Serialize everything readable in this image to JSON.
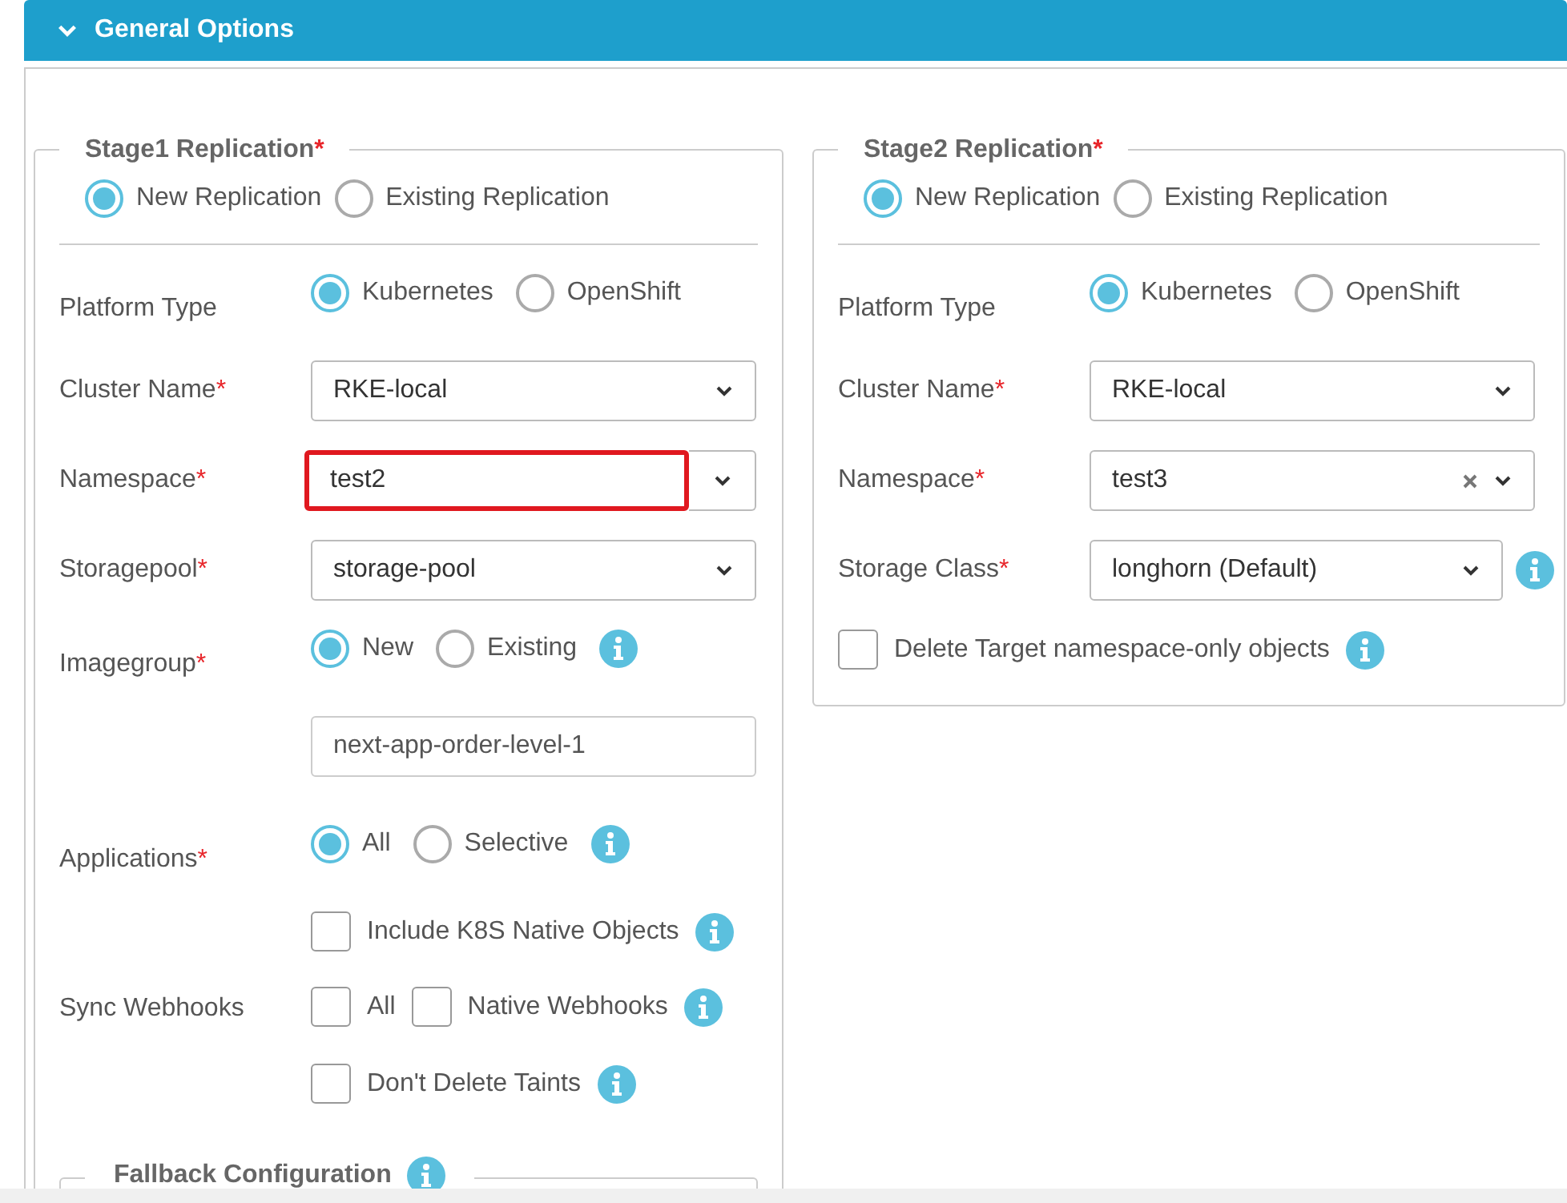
{
  "header": {
    "title": "General Options",
    "expanded": true
  },
  "stages": [
    {
      "title": "Stage1 Replication",
      "mark": "*",
      "modes": [
        {
          "label": "New Replication",
          "selected": true
        },
        {
          "label": "Existing Replication",
          "selected": false
        }
      ],
      "fields": [
        {
          "kind": "radio",
          "label": "Platform Type",
          "options": [
            {
              "label": "Kubernetes",
              "selected": true
            },
            {
              "label": "OpenShift",
              "selected": false
            }
          ]
        },
        {
          "kind": "select",
          "label": "Cluster Name",
          "mark": "*",
          "value": "RKE-local"
        },
        {
          "kind": "select",
          "label": "Namespace",
          "mark": "*",
          "value": "test2",
          "highlighted": true
        },
        {
          "kind": "select",
          "label": "Storagepool",
          "mark": "*",
          "value": "storage-pool"
        },
        {
          "kind": "radio",
          "label": "Imagegroup",
          "mark": "*",
          "info": true,
          "options": [
            {
              "label": "New",
              "selected": true
            },
            {
              "label": "Existing",
              "selected": false
            }
          ]
        },
        {
          "kind": "text",
          "value": "next-app-order-level-1"
        },
        {
          "kind": "radio",
          "label": "Applications",
          "mark": "*",
          "info": true,
          "options": [
            {
              "label": "All",
              "selected": true
            },
            {
              "label": "Selective",
              "selected": false
            }
          ]
        },
        {
          "kind": "checkbox",
          "info": true,
          "options": [
            {
              "label": "Include K8S Native Objects",
              "checked": false
            }
          ]
        },
        {
          "kind": "checkbox",
          "label": "Sync Webhooks",
          "info": true,
          "options": [
            {
              "label": "All",
              "checked": false
            },
            {
              "label": "Native Webhooks",
              "checked": false
            }
          ]
        },
        {
          "kind": "checkbox",
          "info": true,
          "options": [
            {
              "label": "Don't Delete Taints",
              "checked": false
            }
          ]
        }
      ],
      "subsection": {
        "title": "Fallback Configuration",
        "info": true
      }
    },
    {
      "title": "Stage2 Replication",
      "mark": "*",
      "modes": [
        {
          "label": "New Replication",
          "selected": true
        },
        {
          "label": "Existing Replication",
          "selected": false
        }
      ],
      "fields": [
        {
          "kind": "radio",
          "label": "Platform Type",
          "options": [
            {
              "label": "Kubernetes",
              "selected": true
            },
            {
              "label": "OpenShift",
              "selected": false
            }
          ]
        },
        {
          "kind": "select",
          "label": "Cluster Name",
          "mark": "*",
          "value": "RKE-local"
        },
        {
          "kind": "select",
          "label": "Namespace",
          "mark": "*",
          "value": "test3",
          "clearable": true
        },
        {
          "kind": "select",
          "label": "Storage Class",
          "mark": "*",
          "value": "longhorn (Default)",
          "info": true
        },
        {
          "kind": "wide-checkbox",
          "info": true,
          "options": [
            {
              "label": "Delete Target namespace-only objects",
              "checked": false
            }
          ]
        }
      ]
    }
  ]
}
